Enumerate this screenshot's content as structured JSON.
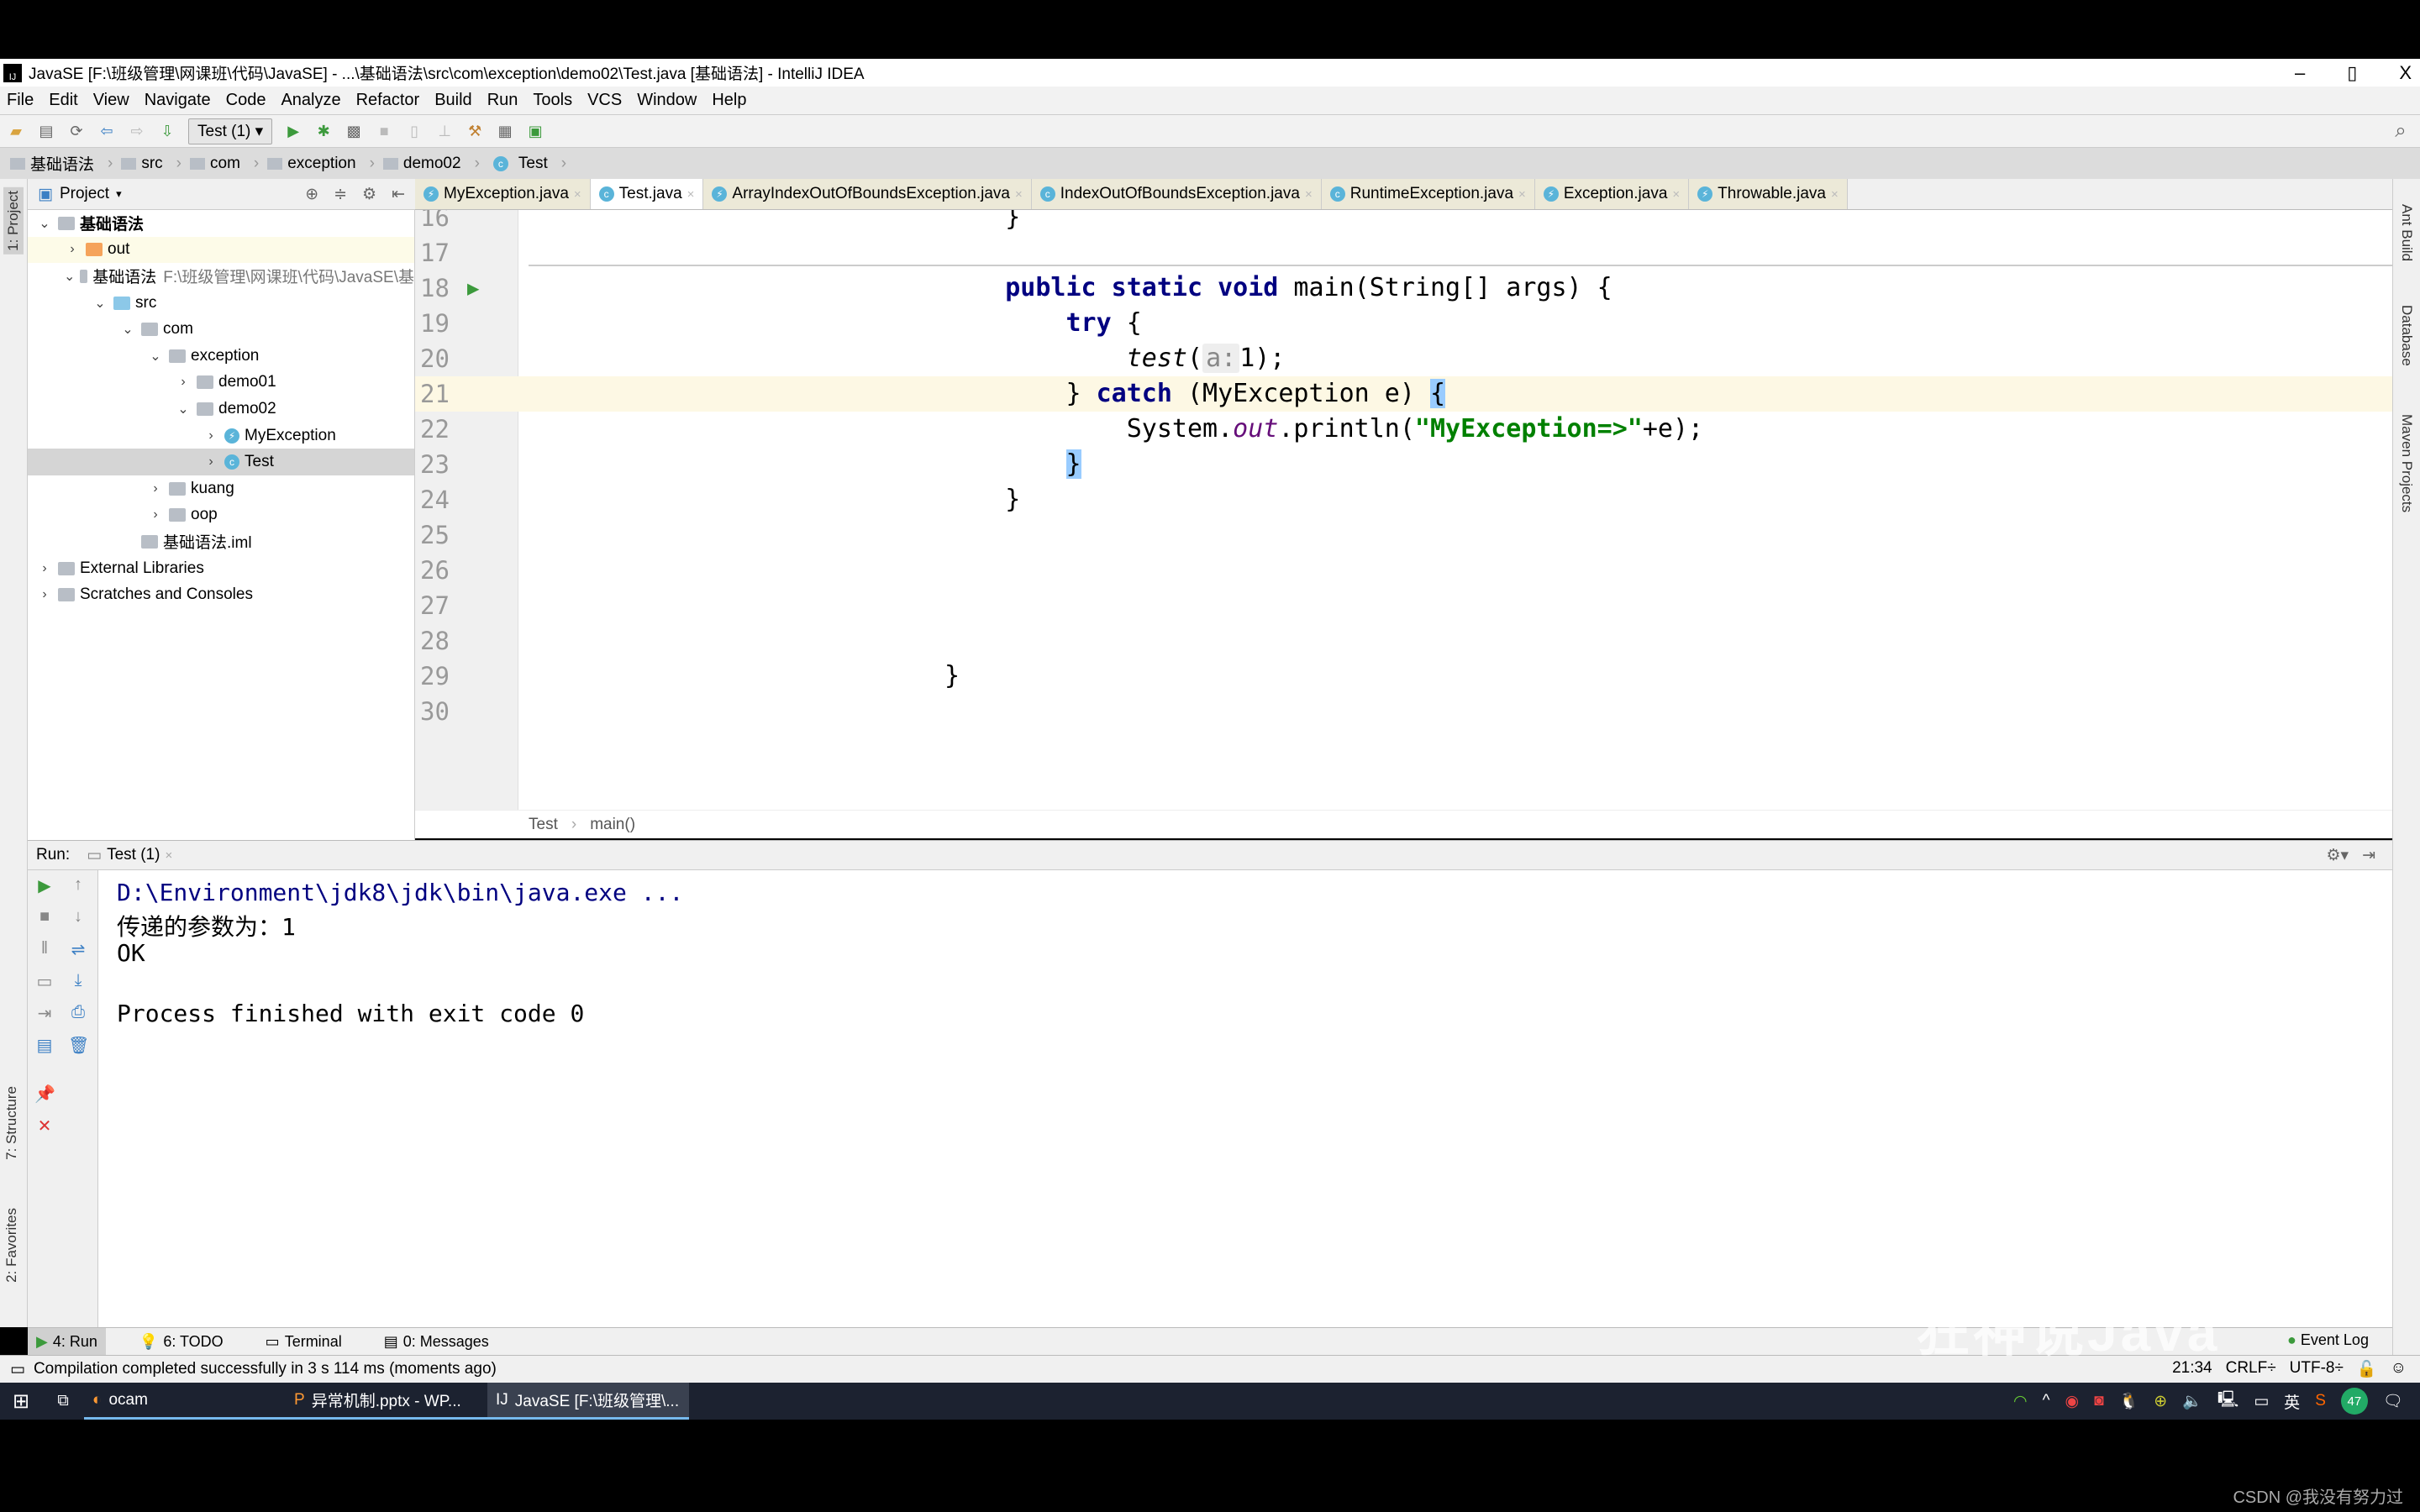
{
  "window": {
    "title": "JavaSE [F:\\班级管理\\网课班\\代码\\JavaSE] - ...\\基础语法\\src\\com\\exception\\demo02\\Test.java [基础语法] - IntelliJ IDEA",
    "minimize": "–",
    "maximize": "▯",
    "close": "X"
  },
  "menu": [
    "File",
    "Edit",
    "View",
    "Navigate",
    "Code",
    "Analyze",
    "Refactor",
    "Build",
    "Run",
    "Tools",
    "VCS",
    "Window",
    "Help"
  ],
  "toolbar": {
    "run_config": "Test (1)"
  },
  "breadcrumb": [
    "基础语法",
    "src",
    "com",
    "exception",
    "demo02",
    "Test"
  ],
  "left_stripe": {
    "project": "1: Project",
    "structure": "7: Structure",
    "favorites": "2: Favorites"
  },
  "right_stripe": [
    "Ant Build",
    "Database",
    "Maven Projects"
  ],
  "project": {
    "header": "Project",
    "tree": [
      {
        "label": "基础语法",
        "depth": 0,
        "arrow": "v",
        "icon": "module",
        "bold": true
      },
      {
        "label": "out",
        "depth": 1,
        "arrow": ">",
        "icon": "out",
        "hl": true
      },
      {
        "label": "基础语法",
        "path": "F:\\班级管理\\网课班\\代码\\JavaSE\\基",
        "depth": 1,
        "arrow": "v",
        "icon": "module"
      },
      {
        "label": "src",
        "depth": 2,
        "arrow": "v",
        "icon": "src"
      },
      {
        "label": "com",
        "depth": 3,
        "arrow": "v",
        "icon": "folder"
      },
      {
        "label": "exception",
        "depth": 4,
        "arrow": "v",
        "icon": "folder"
      },
      {
        "label": "demo01",
        "depth": 5,
        "arrow": ">",
        "icon": "folder"
      },
      {
        "label": "demo02",
        "depth": 5,
        "arrow": "v",
        "icon": "folder"
      },
      {
        "label": "MyException",
        "depth": 6,
        "arrow": ">",
        "icon": "exception"
      },
      {
        "label": "Test",
        "depth": 6,
        "arrow": ">",
        "icon": "class",
        "selected": true
      },
      {
        "label": "kuang",
        "depth": 4,
        "arrow": ">",
        "icon": "folder"
      },
      {
        "label": "oop",
        "depth": 4,
        "arrow": ">",
        "icon": "folder"
      },
      {
        "label": "基础语法.iml",
        "depth": 3,
        "arrow": "",
        "icon": "file"
      },
      {
        "label": "External Libraries",
        "depth": 0,
        "arrow": ">",
        "icon": "library"
      },
      {
        "label": "Scratches and Consoles",
        "depth": 0,
        "arrow": ">",
        "icon": "scratch"
      }
    ]
  },
  "tabs": [
    {
      "label": "MyException.java",
      "icon": "exception"
    },
    {
      "label": "Test.java",
      "icon": "class",
      "active": true
    },
    {
      "label": "ArrayIndexOutOfBoundsException.java",
      "icon": "exception"
    },
    {
      "label": "IndexOutOfBoundsException.java",
      "icon": "class"
    },
    {
      "label": "RuntimeException.java",
      "icon": "class"
    },
    {
      "label": "Exception.java",
      "icon": "exception"
    },
    {
      "label": "Throwable.java",
      "icon": "exception"
    }
  ],
  "code": [
    {
      "n": "16",
      "tokens": [
        {
          "t": "    }"
        }
      ]
    },
    {
      "n": "17",
      "tokens": []
    },
    {
      "n": "18",
      "run": true,
      "tokens": [
        {
          "t": "    "
        },
        {
          "t": "public static void ",
          "c": "kw"
        },
        {
          "t": "main(String[] args) {"
        }
      ]
    },
    {
      "n": "19",
      "tokens": [
        {
          "t": "        "
        },
        {
          "t": "try",
          "c": "kw"
        },
        {
          "t": " {"
        }
      ]
    },
    {
      "n": "20",
      "tokens": [
        {
          "t": "            "
        },
        {
          "t": "test",
          "c": "it"
        },
        {
          "t": "("
        },
        {
          "t": "a:",
          "c": "hint"
        },
        {
          "t": "1);"
        }
      ]
    },
    {
      "n": "21",
      "current": true,
      "tokens": [
        {
          "t": "        } "
        },
        {
          "t": "catch",
          "c": "kw"
        },
        {
          "t": " (MyException e) "
        },
        {
          "t": "{",
          "c": "brace"
        }
      ]
    },
    {
      "n": "22",
      "tokens": [
        {
          "t": "            System."
        },
        {
          "t": "out",
          "c": "fld"
        },
        {
          "t": ".println("
        },
        {
          "t": "\"MyException=>\"",
          "c": "str"
        },
        {
          "t": "+e);"
        }
      ]
    },
    {
      "n": "23",
      "tokens": [
        {
          "t": "        "
        },
        {
          "t": "}",
          "c": "brace"
        }
      ]
    },
    {
      "n": "24",
      "tokens": [
        {
          "t": "    }"
        }
      ]
    },
    {
      "n": "25",
      "tokens": []
    },
    {
      "n": "26",
      "tokens": []
    },
    {
      "n": "27",
      "tokens": []
    },
    {
      "n": "28",
      "tokens": []
    },
    {
      "n": "29",
      "tokens": [
        {
          "t": "}"
        }
      ]
    },
    {
      "n": "30",
      "tokens": []
    }
  ],
  "editor_breadcrumb": [
    "Test",
    "main()"
  ],
  "run": {
    "label": "Run:",
    "tab": "Test (1)",
    "output": [
      "D:\\Environment\\jdk8\\jdk\\bin\\java.exe ...",
      "传递的参数为：1",
      "OK",
      "",
      "Process finished with exit code 0"
    ]
  },
  "toolwindows": [
    "4: Run",
    "6: TODO",
    "Terminal",
    "0: Messages"
  ],
  "event_log": "Event Log",
  "status": {
    "message": "Compilation completed successfully in 3 s 114 ms (moments ago)",
    "position": "21:34",
    "line_sep": "CRLF÷",
    "encoding": "UTF-8÷"
  },
  "taskbar": {
    "tasks": [
      "ocam",
      "异常机制.pptx - WP...",
      "JavaSE [F:\\班级管理\\..."
    ],
    "ime": "英",
    "badge": "47"
  },
  "watermark": "狂神说Java",
  "csdn": "CSDN @我没有努力过",
  "colors": {
    "keyword": "#000080",
    "string": "#008000",
    "field": "#660e7a",
    "current_line": "#fdf8e4",
    "brace_match": "#99ccff",
    "run_green": "#3c9a3c"
  }
}
